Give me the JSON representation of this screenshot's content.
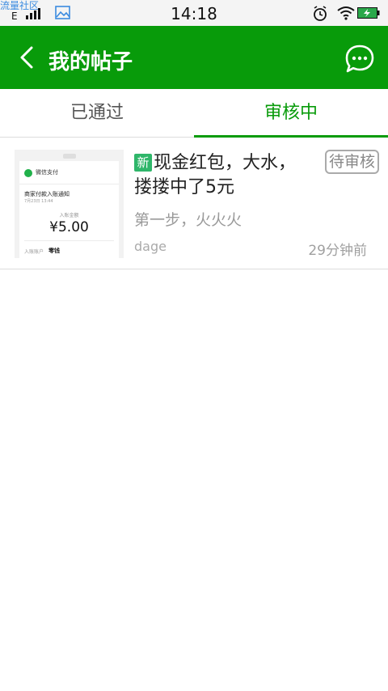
{
  "status_bar": {
    "app_name": "流量社区",
    "network": "E",
    "time": "14:18",
    "icons": [
      "signal-icon",
      "gallery-icon",
      "alarm-icon",
      "wifi-icon",
      "battery-icon"
    ],
    "battery_color": "#2aa84a"
  },
  "header": {
    "title": "我的帖子",
    "back_icon": "back-arrow-icon",
    "action_icon": "chat-bubble-icon",
    "background_color": "#089b0a"
  },
  "tabs": {
    "items": [
      {
        "label": "已通过",
        "active": false
      },
      {
        "label": "审核中",
        "active": true
      }
    ],
    "active_color": "#089b0a"
  },
  "posts": [
    {
      "badge": "新",
      "title": "现金红包，大水，搂搂中了5元",
      "status": "待审核",
      "summary": "第一步，火火火",
      "author": "dage",
      "time": "29分钟前",
      "thumbnail": {
        "pay_label": "微信支付",
        "notice": "商家付款入账通知",
        "date": "7月23日 13:44",
        "amount_label": "入账金额",
        "amount": "¥5.00",
        "account_label": "入账账户",
        "account_value": "零钱"
      }
    }
  ]
}
